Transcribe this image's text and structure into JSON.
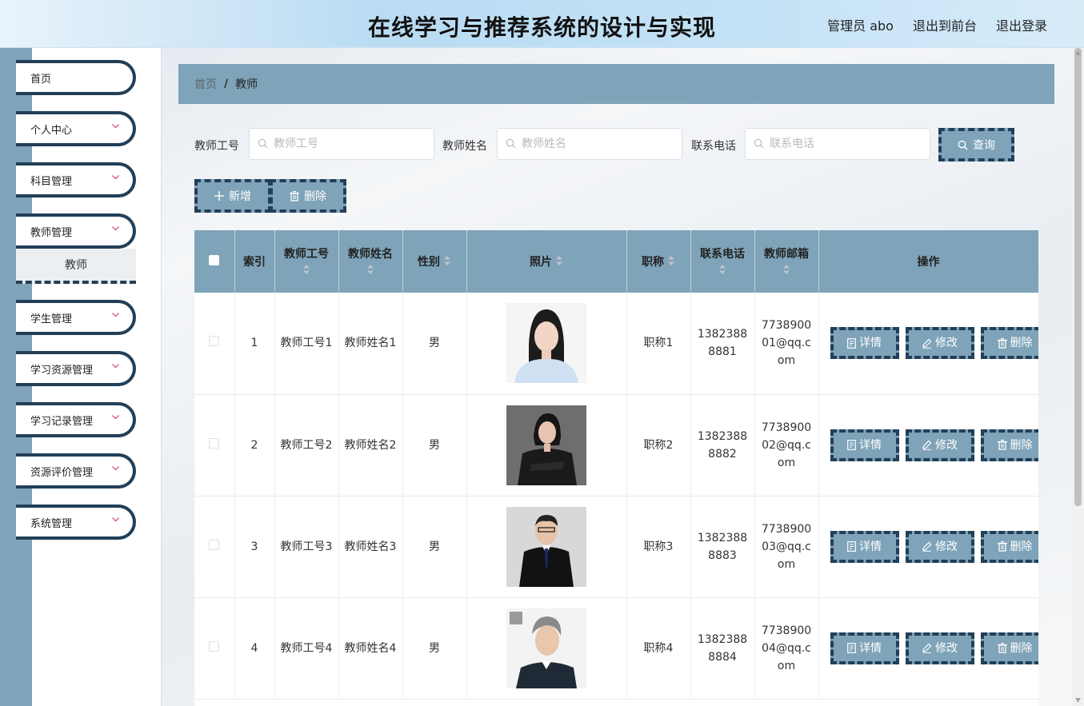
{
  "header": {
    "title": "在线学习与推荐系统的设计与实现",
    "user": "管理员 abo",
    "to_front": "退出到前台",
    "logout": "退出登录"
  },
  "sidebar": {
    "items": [
      {
        "label": "首页",
        "has_chevron": false
      },
      {
        "label": "个人中心",
        "has_chevron": true
      },
      {
        "label": "科目管理",
        "has_chevron": true
      },
      {
        "label": "教师管理",
        "has_chevron": true
      },
      {
        "label": "学生管理",
        "has_chevron": true
      },
      {
        "label": "学习资源管理",
        "has_chevron": true
      },
      {
        "label": "学习记录管理",
        "has_chevron": true
      },
      {
        "label": "资源评价管理",
        "has_chevron": true
      },
      {
        "label": "系统管理",
        "has_chevron": true
      }
    ],
    "active_sub": "教师"
  },
  "breadcrumb": {
    "home": "首页",
    "separator": "/",
    "current": "教师"
  },
  "search": {
    "fields": [
      {
        "label": "教师工号",
        "placeholder": "教师工号",
        "value": ""
      },
      {
        "label": "教师姓名",
        "placeholder": "教师姓名",
        "value": ""
      },
      {
        "label": "联系电话",
        "placeholder": "联系电话",
        "value": ""
      }
    ],
    "query_label": "查询"
  },
  "actions": {
    "add_label": "新增",
    "delete_label": "删除"
  },
  "table": {
    "columns": [
      "索引",
      "教师工号",
      "教师姓名",
      "性别",
      "照片",
      "职称",
      "联系电话",
      "教师邮箱",
      "操作"
    ],
    "row_actions": {
      "detail": "详情",
      "edit": "修改",
      "delete": "删除"
    },
    "rows": [
      {
        "index": "1",
        "code": "教师工号1",
        "name": "教师姓名1",
        "gender": "男",
        "photo": "portrait-woman-light-blue-shirt",
        "title": "职称1",
        "phone": "13823888881",
        "email": "773890001@qq.com"
      },
      {
        "index": "2",
        "code": "教师工号2",
        "name": "教师姓名2",
        "gender": "男",
        "photo": "portrait-woman-black-suit",
        "title": "职称2",
        "phone": "13823888882",
        "email": "773890002@qq.com"
      },
      {
        "index": "3",
        "code": "教师工号3",
        "name": "教师姓名3",
        "gender": "男",
        "photo": "portrait-man-black-suit",
        "title": "职称3",
        "phone": "13823888883",
        "email": "773890003@qq.com"
      },
      {
        "index": "4",
        "code": "教师工号4",
        "name": "教师姓名4",
        "gender": "男",
        "photo": "portrait-man-gray-hair",
        "title": "职称4",
        "phone": "13823888884",
        "email": "773890004@qq.com"
      }
    ]
  },
  "colors": {
    "accent": "#7fa3b8",
    "dark": "#223f57",
    "header_bg": "#c4e2f6",
    "chevron": "#d13f6a"
  }
}
